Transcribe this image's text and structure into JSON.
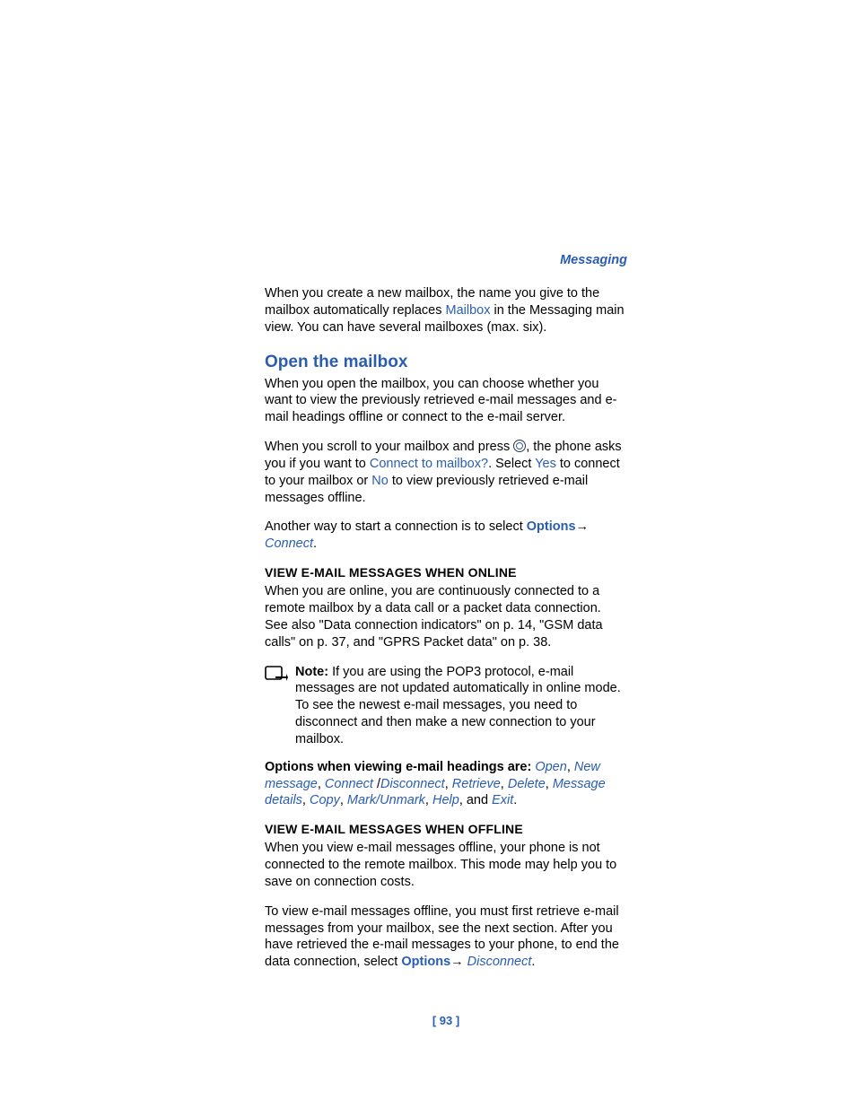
{
  "breadcrumb": "Messaging",
  "intro": {
    "p1a": "When you create a new mailbox, the name you give to the mailbox automatically replaces ",
    "p1_link": "Mailbox",
    "p1b": " in the Messaging main view. You can have several mailboxes (max. six)."
  },
  "section_title": "Open the mailbox",
  "open": {
    "p1": "When you open the mailbox, you can choose whether you want to view the previously retrieved e-mail messages and e-mail headings offline or connect to the e-mail server.",
    "p2a": "When you scroll to your mailbox and press ",
    "p2b": ", the phone asks you if you want to ",
    "p2_link1": "Connect to mailbox?",
    "p2c": ". Select ",
    "p2_link2": "Yes",
    "p2d": " to connect to your mailbox or ",
    "p2_link3": "No",
    "p2e": " to view previously retrieved e-mail messages offline.",
    "p3a": "Another way to start a connection is to select ",
    "p3_opt": "Options",
    "p3_arrow": "→ ",
    "p3_link": "Connect",
    "p3b": "."
  },
  "sub_online_title": "VIEW E-MAIL MESSAGES WHEN ONLINE",
  "online": {
    "p1": "When you are online, you are continuously connected to a remote mailbox by a data call or a packet data connection. See also \"Data connection indicators\" on p. 14, \"GSM data calls\" on p. 37, and \"GPRS Packet data\" on p. 38."
  },
  "note": {
    "label": "Note:",
    "text": " If you are using the POP3 protocol, e-mail messages are not updated automatically in online mode. To see the newest e-mail messages, you need to disconnect and then make a new connection to your mailbox."
  },
  "options_line": {
    "lead": "Options when viewing e-mail headings are: ",
    "o1": "Open",
    "c1": ", ",
    "o2": "New message",
    "c2": ", ",
    "o3": "Connect",
    "c3": " /",
    "o4": "Disconnect",
    "c4": ", ",
    "o5": "Retrieve",
    "c5": ", ",
    "o6": "Delete",
    "c6": ", ",
    "o7": "Message details",
    "c7": ", ",
    "o8": "Copy",
    "c8": ", ",
    "o9": "Mark/Unmark",
    "c9": ", ",
    "o10": "Help",
    "c10": ", and ",
    "o11": "Exit",
    "c11": "."
  },
  "sub_offline_title": "VIEW E-MAIL MESSAGES WHEN OFFLINE",
  "offline": {
    "p1": "When you view e-mail messages offline, your phone is not connected to the remote mailbox. This mode may help you to save on connection costs.",
    "p2a": "To view e-mail messages offline, you must first retrieve e-mail messages from your mailbox, see the next section. After you have retrieved the e-mail messages to your phone, to end the data connection, select ",
    "p2_opt": "Options",
    "p2_arrow": "→ ",
    "p2_link": "Disconnect",
    "p2b": "."
  },
  "page_number": "[ 93 ]"
}
